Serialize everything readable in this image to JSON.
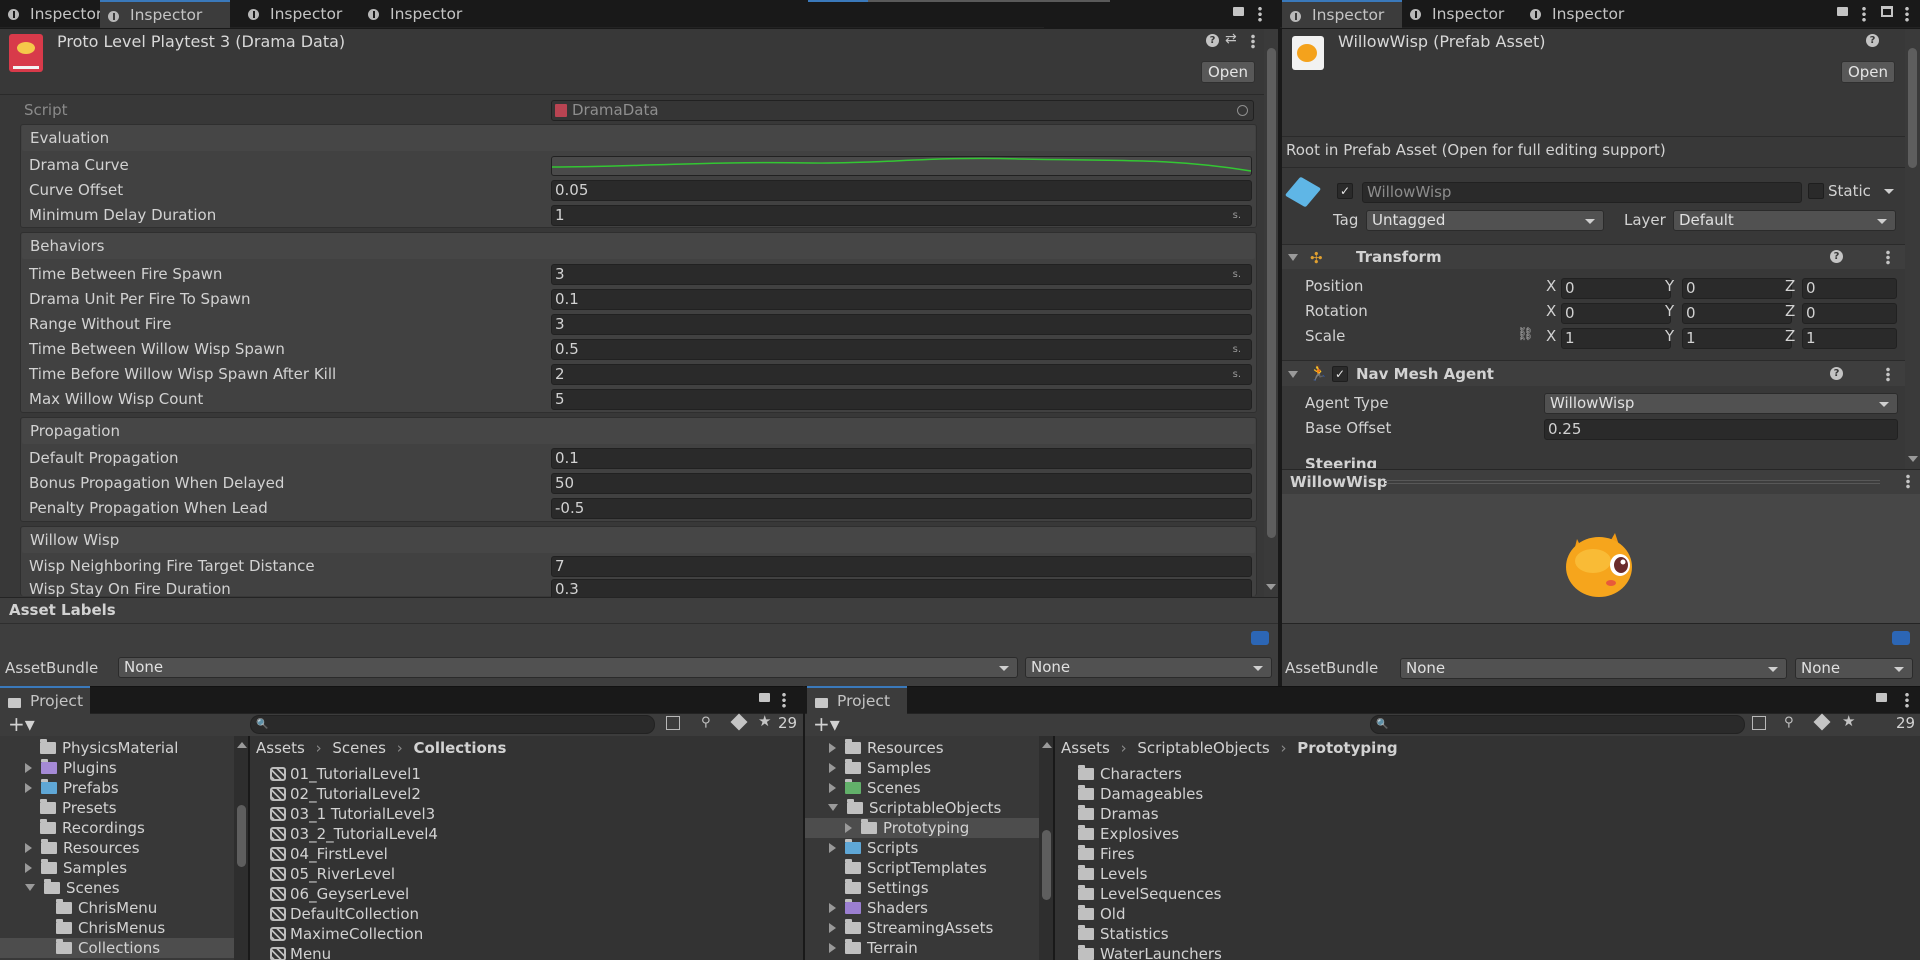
{
  "left_inspector": {
    "tabs": [
      "Inspector",
      "Inspector",
      "Inspector",
      "Inspector"
    ],
    "asset_title": "Proto Level Playtest 3 (Drama Data)",
    "open_label": "Open",
    "script_label": "Script",
    "script_value": "DramaData",
    "sections": [
      {
        "title": "Evaluation",
        "rows": [
          {
            "label": "Drama Curve",
            "value": "",
            "unit": ""
          },
          {
            "label": "Curve Offset",
            "value": "0.05",
            "unit": ""
          },
          {
            "label": "Minimum Delay Duration",
            "value": "1",
            "unit": "s."
          }
        ]
      },
      {
        "title": "Behaviors",
        "rows": [
          {
            "label": "Time Between Fire Spawn",
            "value": "3",
            "unit": "s."
          },
          {
            "label": "Drama Unit Per Fire To Spawn",
            "value": "0.1",
            "unit": ""
          },
          {
            "label": "Range Without Fire",
            "value": "3",
            "unit": ""
          },
          {
            "label": "Time Between Willow Wisp Spawn",
            "value": "0.5",
            "unit": "s."
          },
          {
            "label": "Time Before Willow Wisp Spawn After Kill",
            "value": "2",
            "unit": "s."
          },
          {
            "label": "Max Willow Wisp Count",
            "value": "5",
            "unit": ""
          }
        ]
      },
      {
        "title": "Propagation",
        "rows": [
          {
            "label": "Default Propagation",
            "value": "0.1",
            "unit": ""
          },
          {
            "label": "Bonus Propagation When Delayed",
            "value": "50",
            "unit": ""
          },
          {
            "label": "Penalty Propagation When Lead",
            "value": "-0.5",
            "unit": ""
          }
        ]
      },
      {
        "title": "Willow Wisp",
        "rows": [
          {
            "label": "Wisp Neighboring Fire Target Distance",
            "value": "7",
            "unit": ""
          },
          {
            "label": "Wisp Stay On Fire Duration",
            "value": "0.3",
            "unit": ""
          }
        ]
      }
    ],
    "asset_labels": "Asset Labels",
    "assetbundle_label": "AssetBundle",
    "assetbundle_value": "None",
    "assetbundle_variant": "None"
  },
  "right_inspector": {
    "tabs": [
      "Inspector",
      "Inspector",
      "Inspector"
    ],
    "asset_title": "WillowWisp (Prefab Asset)",
    "open_label": "Open",
    "root_note": "Root in Prefab Asset (Open for full editing support)",
    "object_name": "WillowWisp",
    "static_label": "Static",
    "tag_label": "Tag",
    "tag_value": "Untagged",
    "layer_label": "Layer",
    "layer_value": "Default",
    "transform_title": "Transform",
    "transform_rows": [
      {
        "label": "Position",
        "x": "0",
        "y": "0",
        "z": "0"
      },
      {
        "label": "Rotation",
        "x": "0",
        "y": "0",
        "z": "0"
      },
      {
        "label": "Scale",
        "x": "1",
        "y": "1",
        "z": "1"
      }
    ],
    "axis_x": "X",
    "axis_y": "Y",
    "axis_z": "Z",
    "navmesh_title": "Nav Mesh Agent",
    "agent_type_label": "Agent Type",
    "agent_type_value": "WillowWisp",
    "base_offset_label": "Base Offset",
    "base_offset_value": "0.25",
    "steering_label": "Steering",
    "preview_title": "WillowWisp",
    "assetbundle_label": "AssetBundle",
    "assetbundle_value": "None",
    "assetbundle_variant": "None"
  },
  "left_project": {
    "tab": "Project",
    "hidden_count": "29",
    "tree": [
      "PhysicsMaterial",
      "Plugins",
      "Prefabs",
      "Presets",
      "Recordings",
      "Resources",
      "Samples",
      "Scenes",
      "ChrisMenu",
      "ChrisMenus",
      "Collections"
    ],
    "breadcrumb": [
      "Assets",
      "Scenes",
      "Collections"
    ],
    "files": [
      "01_TutorialLevel1",
      "02_TutorialLevel2",
      "03_1 TutorialLevel3",
      "03_2_TutorialLevel4",
      "04_FirstLevel",
      "05_RiverLevel",
      "06_GeyserLevel",
      "DefaultCollection",
      "MaximeCollection",
      "Menu"
    ]
  },
  "right_project": {
    "tab": "Project",
    "hidden_count": "29",
    "tree": [
      "Resources",
      "Samples",
      "Scenes",
      "ScriptableObjects",
      "Prototyping",
      "Scripts",
      "ScriptTemplates",
      "Settings",
      "Shaders",
      "StreamingAssets",
      "Terrain"
    ],
    "breadcrumb": [
      "Assets",
      "ScriptableObjects",
      "Prototyping"
    ],
    "folders": [
      "Characters",
      "Damageables",
      "Dramas",
      "Explosives",
      "Fires",
      "Levels",
      "LevelSequences",
      "Old",
      "Statistics",
      "WaterLaunchers"
    ]
  },
  "colors": {
    "accent": "#3a79bb",
    "curve": "#2fbf2f",
    "panel": "#383838"
  }
}
